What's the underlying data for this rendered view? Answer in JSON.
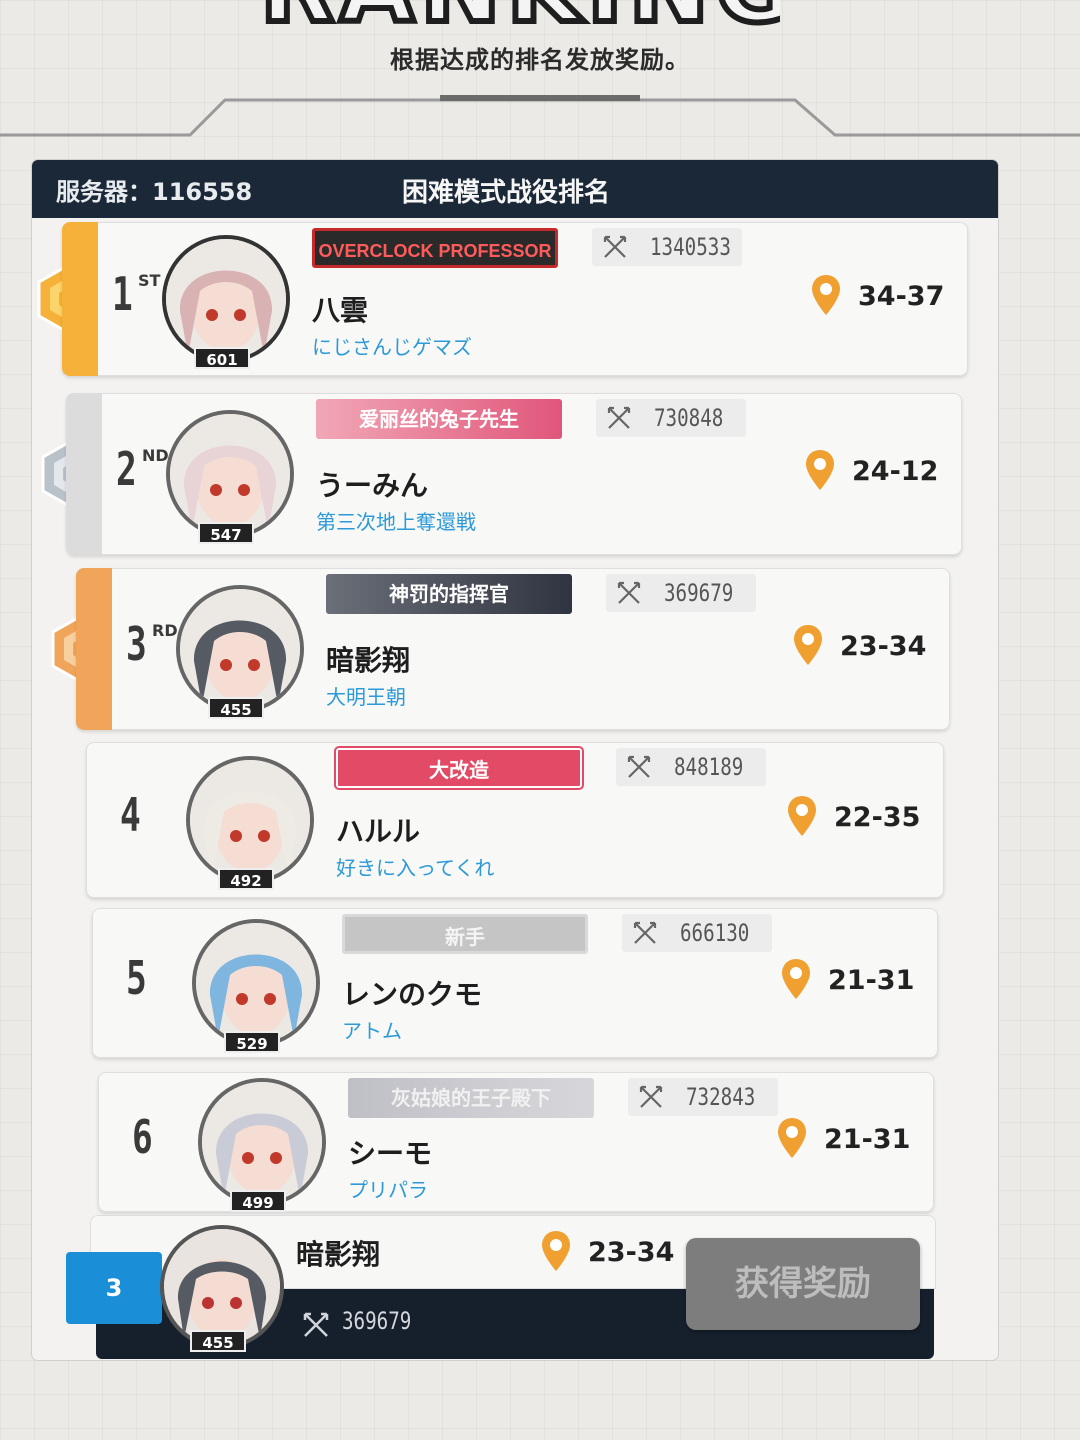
{
  "page": {
    "banner_title": "RANKING",
    "subtitle": "根据达成的排名发放奖励。"
  },
  "header": {
    "server": "服务器：116558",
    "title": "困难模式战役排名"
  },
  "colors": {
    "gold": "#f5b13a",
    "silver": "#c9ccd0",
    "bronze": "#f3b066",
    "guild_blue": "#2d9ad8",
    "pin_orange": "#f0a030",
    "header_navy": "#1b2838",
    "self_blue": "#1a8fd8"
  },
  "rankings": [
    {
      "rank": "1",
      "suffix": "ST",
      "name": "八雲",
      "guild": "にじさんじゲマズ",
      "level": "601",
      "title": "OVERCLOCK PROFESSOR",
      "title_style": "overclock",
      "power": "1340533",
      "stage": "34-37",
      "medal": "gold",
      "avatar_hair": "#d9b3b3"
    },
    {
      "rank": "2",
      "suffix": "ND",
      "name": "うーみん",
      "guild": "第三次地上奪還戦",
      "level": "547",
      "title": "爱丽丝的兔子先生",
      "title_style": "alice",
      "power": "730848",
      "stage": "24-12",
      "medal": "silver",
      "avatar_hair": "#e8d3d6"
    },
    {
      "rank": "3",
      "suffix": "RD",
      "name": "暗影翔",
      "guild": "大明王朝",
      "level": "455",
      "title": "神罚的指挥官",
      "title_style": "dark",
      "power": "369679",
      "stage": "23-34",
      "medal": "bronze",
      "avatar_hair": "#555a63"
    },
    {
      "rank": "4",
      "suffix": "",
      "name": "ハルル",
      "guild": "好きに入ってくれ",
      "level": "492",
      "title": "大改造",
      "title_style": "red",
      "power": "848189",
      "stage": "22-35",
      "medal": "",
      "avatar_hair": "#eeeae4"
    },
    {
      "rank": "5",
      "suffix": "",
      "name": "レンのクモ",
      "guild": "アトム",
      "level": "529",
      "title": "新手",
      "title_style": "gray",
      "power": "666130",
      "stage": "21-31",
      "medal": "",
      "avatar_hair": "#7fb6e0"
    },
    {
      "rank": "6",
      "suffix": "",
      "name": "シーモ",
      "guild": "プリパラ",
      "level": "499",
      "title": "灰姑娘的王子殿下",
      "title_style": "faded",
      "power": "732843",
      "stage": "21-31",
      "medal": "",
      "avatar_hair": "#c9ccd6"
    }
  ],
  "self": {
    "rank": "3",
    "name": "暗影翔",
    "stage": "23-34",
    "power": "369679",
    "level": "455",
    "claim_label": "获得奖励"
  }
}
